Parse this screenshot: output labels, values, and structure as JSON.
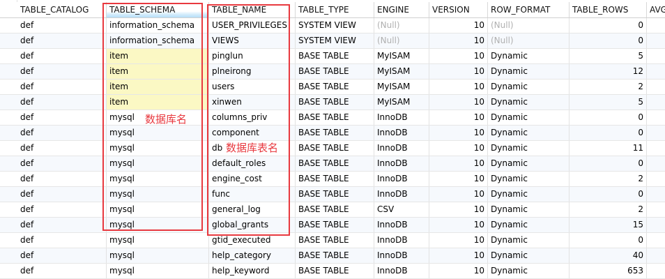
{
  "columns": [
    "TABLE_CATALOG",
    "TABLE_SCHEMA",
    "TABLE_NAME",
    "TABLE_TYPE",
    "ENGINE",
    "VERSION",
    "ROW_FORMAT",
    "TABLE_ROWS",
    "AVG"
  ],
  "sorted_column": "TABLE_SCHEMA",
  "rows": [
    [
      "def",
      "information_schema",
      "USER_PRIVILEGES",
      "SYSTEM VIEW",
      "(Null)",
      "10",
      "(Null)",
      "0"
    ],
    [
      "def",
      "information_schema",
      "VIEWS",
      "SYSTEM VIEW",
      "(Null)",
      "10",
      "(Null)",
      "0"
    ],
    [
      "def",
      "item",
      "pinglun",
      "BASE TABLE",
      "MyISAM",
      "10",
      "Dynamic",
      "5"
    ],
    [
      "def",
      "item",
      "plneirong",
      "BASE TABLE",
      "MyISAM",
      "10",
      "Dynamic",
      "12"
    ],
    [
      "def",
      "item",
      "users",
      "BASE TABLE",
      "MyISAM",
      "10",
      "Dynamic",
      "2"
    ],
    [
      "def",
      "item",
      "xinwen",
      "BASE TABLE",
      "MyISAM",
      "10",
      "Dynamic",
      "5"
    ],
    [
      "def",
      "mysql",
      "columns_priv",
      "BASE TABLE",
      "InnoDB",
      "10",
      "Dynamic",
      "0"
    ],
    [
      "def",
      "mysql",
      "component",
      "BASE TABLE",
      "InnoDB",
      "10",
      "Dynamic",
      "0"
    ],
    [
      "def",
      "mysql",
      "db",
      "BASE TABLE",
      "InnoDB",
      "10",
      "Dynamic",
      "11"
    ],
    [
      "def",
      "mysql",
      "default_roles",
      "BASE TABLE",
      "InnoDB",
      "10",
      "Dynamic",
      "0"
    ],
    [
      "def",
      "mysql",
      "engine_cost",
      "BASE TABLE",
      "InnoDB",
      "10",
      "Dynamic",
      "2"
    ],
    [
      "def",
      "mysql",
      "func",
      "BASE TABLE",
      "InnoDB",
      "10",
      "Dynamic",
      "0"
    ],
    [
      "def",
      "mysql",
      "general_log",
      "BASE TABLE",
      "CSV",
      "10",
      "Dynamic",
      "2"
    ],
    [
      "def",
      "mysql",
      "global_grants",
      "BASE TABLE",
      "InnoDB",
      "10",
      "Dynamic",
      "15"
    ],
    [
      "def",
      "mysql",
      "gtid_executed",
      "BASE TABLE",
      "InnoDB",
      "10",
      "Dynamic",
      "0"
    ],
    [
      "def",
      "mysql",
      "help_category",
      "BASE TABLE",
      "InnoDB",
      "10",
      "Dynamic",
      "40"
    ],
    [
      "def",
      "mysql",
      "help_keyword",
      "BASE TABLE",
      "InnoDB",
      "10",
      "Dynamic",
      "653"
    ]
  ],
  "highlight_schema": "item",
  "annotations": {
    "schema_note": "数据库名",
    "table_note": "数据库表名"
  },
  "colors": {
    "annotation": "#e8393f",
    "highlight": "#fbf8c4",
    "null_text": "#b0b0b0",
    "sorted_header": "#b5def8"
  },
  "gutter_glyph": "≡"
}
